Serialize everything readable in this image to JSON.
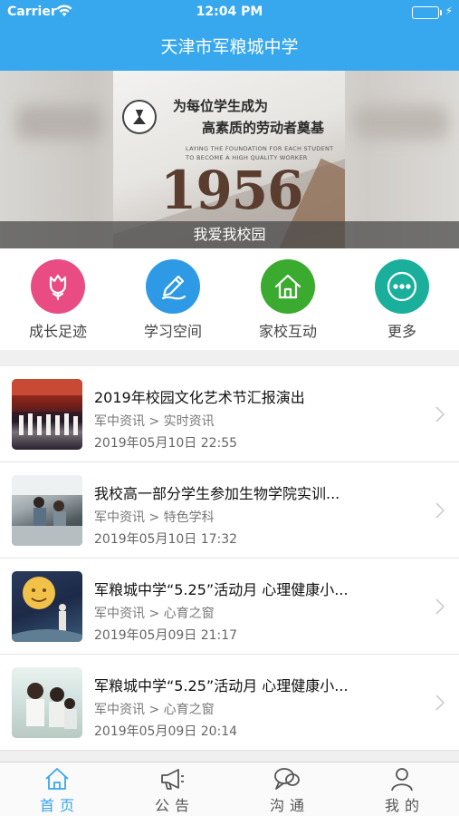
{
  "status_bar": {
    "carrier": "Carrier",
    "time": "12:04 PM",
    "battery_level": 1.0
  },
  "nav": {
    "title": "天津市军粮城中学"
  },
  "banner": {
    "caption": "我爱我校园",
    "slogan_line1": "为每位学生成为",
    "slogan_line2": "高素质的劳动者奠基",
    "english_line1": "LAYING THE FOUNDATION FOR EACH STUDENT",
    "english_line2": "TO BECOME A HIGH QUALITY WORKER",
    "year": "1956"
  },
  "quick_menu": [
    {
      "label": "成长足迹",
      "icon": "tulip-icon",
      "color": "#e94c82"
    },
    {
      "label": "学习空间",
      "icon": "pencil-icon",
      "color": "#2e9ae6"
    },
    {
      "label": "家校互动",
      "icon": "home-icon",
      "color": "#3aab2f"
    },
    {
      "label": "更多",
      "icon": "more-dots-icon",
      "color": "#1aaf9b"
    }
  ],
  "news": [
    {
      "title": "2019年校园文化艺术节汇报演出",
      "category": "军中资讯 > 实时资讯",
      "date": "2019年05月10日 22:55"
    },
    {
      "title": "我校高一部分学生参加生物学院实训...",
      "category": "军中资讯 > 特色学科",
      "date": "2019年05月10日 17:32"
    },
    {
      "title": "军粮城中学“5.25”活动月 心理健康小...",
      "category": "军中资讯 > 心育之窗",
      "date": "2019年05月09日 21:17"
    },
    {
      "title": "军粮城中学“5.25”活动月 心理健康小...",
      "category": "军中资讯 > 心育之窗",
      "date": "2019年05月09日 20:14"
    }
  ],
  "tabs": [
    {
      "label": "首页",
      "icon": "home-tab-icon",
      "active": true
    },
    {
      "label": "公告",
      "icon": "megaphone-icon",
      "active": false
    },
    {
      "label": "沟通",
      "icon": "chat-icon",
      "active": false
    },
    {
      "label": "我的",
      "icon": "user-icon",
      "active": false
    }
  ],
  "colors": {
    "primary": "#37a7ee",
    "tab_active": "#37a7ee",
    "tab_inactive": "#555555"
  }
}
